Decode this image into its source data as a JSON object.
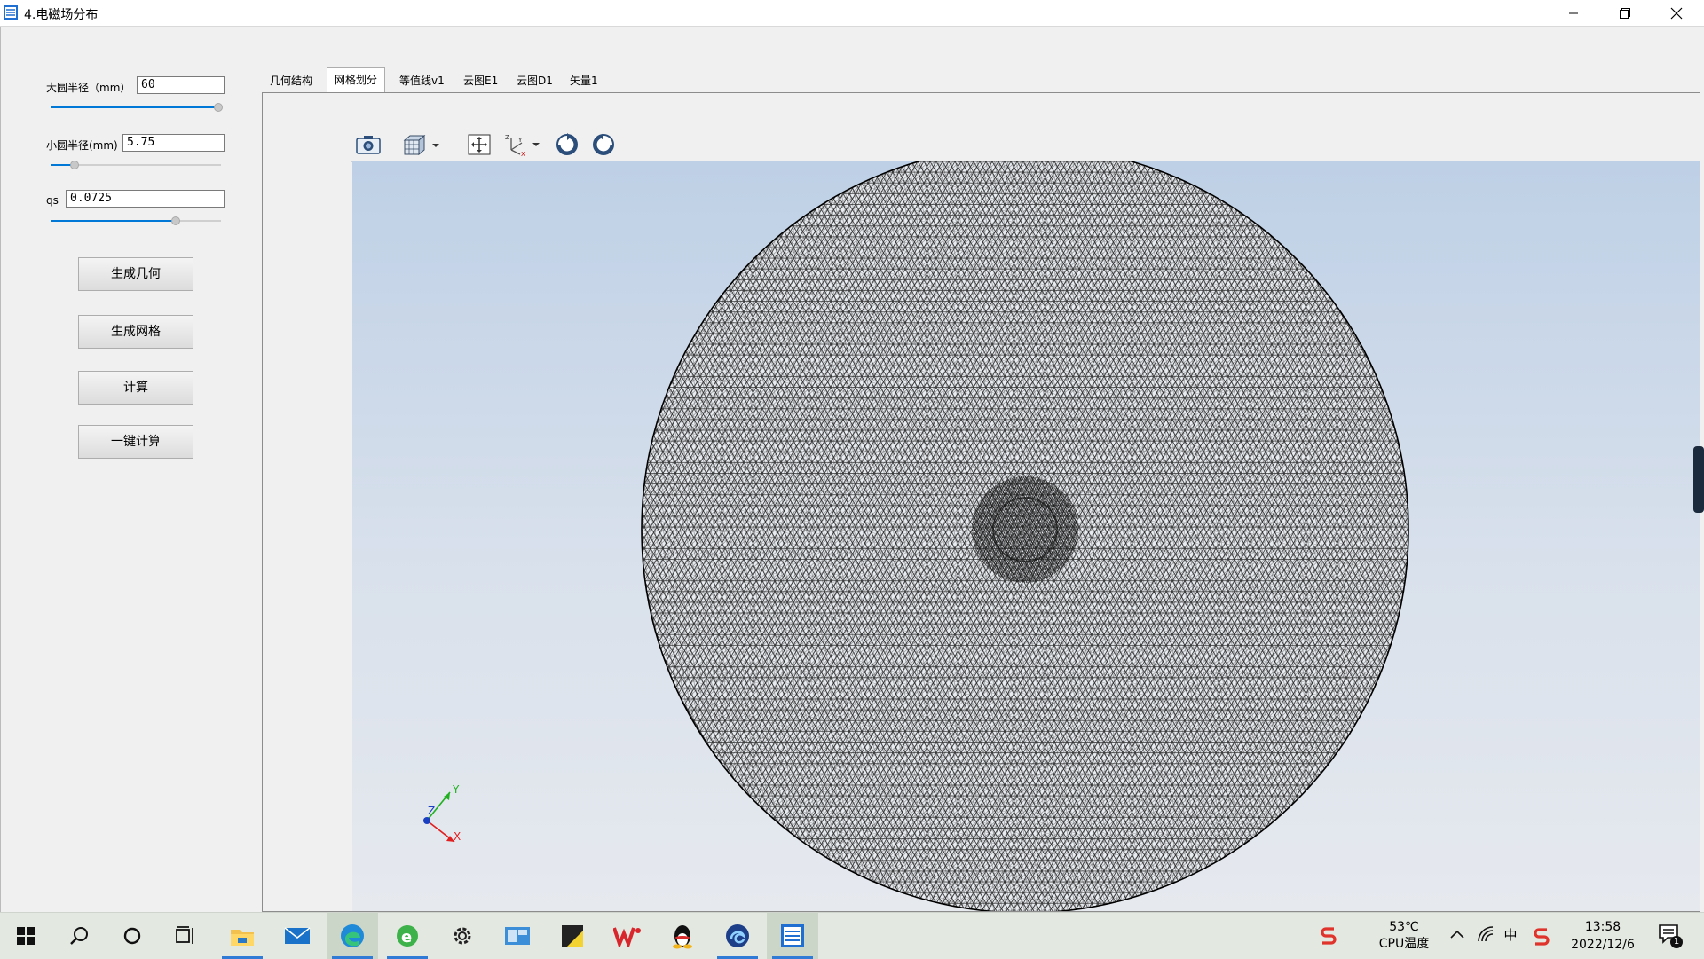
{
  "window": {
    "title": "4.电磁场分布"
  },
  "params": {
    "big_radius": {
      "label": "大圆半径（mm）",
      "value": "60",
      "slider_fraction": 1.0
    },
    "small_radius": {
      "label": "小圆半径(mm)",
      "value": "5.75",
      "slider_fraction": 0.15
    },
    "qs": {
      "label": "qs",
      "value": "0.0725",
      "slider_fraction": 0.74
    }
  },
  "actions": {
    "gen_geometry": "生成几何",
    "gen_mesh": "生成网格",
    "compute": "计算",
    "one_click": "一键计算"
  },
  "tabs": [
    {
      "label": "几何结构",
      "active": false
    },
    {
      "label": "网格划分",
      "active": true
    },
    {
      "label": "等值线v1",
      "active": false
    },
    {
      "label": "云图E1",
      "active": false
    },
    {
      "label": "云图D1",
      "active": false
    },
    {
      "label": "矢量1",
      "active": false
    }
  ],
  "viewer": {
    "toolbar_icons": [
      "camera-icon",
      "view-cube-icon",
      "fit-view-icon",
      "axis-orient-icon",
      "rotate-cw-icon",
      "rotate-ccw-icon"
    ],
    "axes": {
      "x": "X",
      "y": "Y",
      "z": "Z"
    }
  },
  "taskbar": {
    "temperature": "53℃",
    "temp_label": "CPU温度",
    "time": "13:58",
    "date": "2022/12/6",
    "ime": "中",
    "notifications": "1"
  },
  "colors": {
    "accent": "#0078d7",
    "mesh_line": "#000000",
    "viewport_top": "#bed0e6",
    "viewport_bottom": "#e6e9ee"
  }
}
